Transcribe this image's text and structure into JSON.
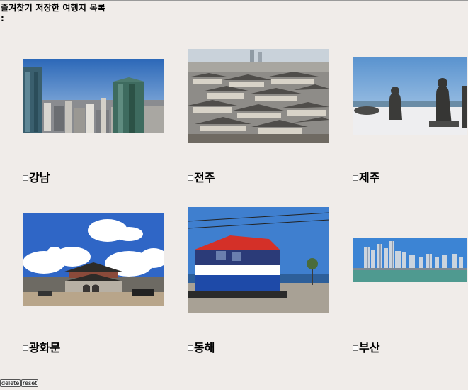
{
  "heading": "즐겨찾기 저장한 여행지 목록 :",
  "trips": [
    {
      "name": "강남",
      "image": "gangnam-skyline-photo"
    },
    {
      "name": "전주",
      "image": "jeonju-hanok-village-photo"
    },
    {
      "name": "제주",
      "image": "jeju-stone-statues-photo"
    },
    {
      "name": "광화문",
      "image": "gwanghwamun-gate-photo"
    },
    {
      "name": "동해",
      "image": "donghae-train-photo"
    },
    {
      "name": "부산",
      "image": "busan-skyline-photo"
    }
  ],
  "buttons": {
    "delete": "delete",
    "reset": "reset"
  }
}
